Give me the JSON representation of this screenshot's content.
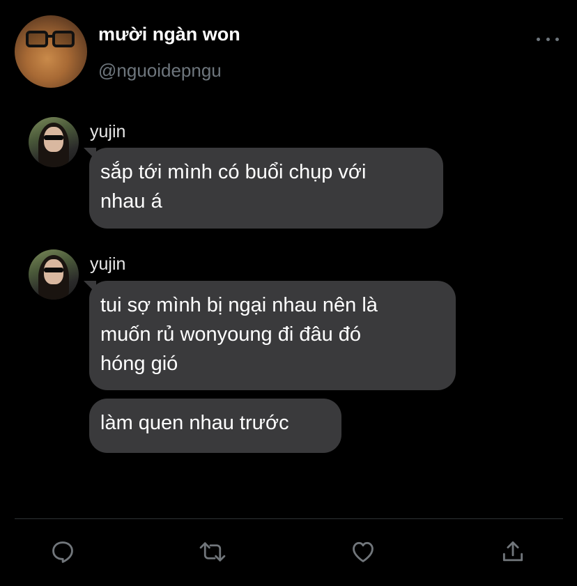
{
  "tweet": {
    "display_name": "mười ngàn won",
    "handle": "@nguoidepngu"
  },
  "messages": [
    {
      "sender": "yujin",
      "bubbles": [
        {
          "lines": [
            "sắp tới mình có buổi chụp với",
            "nhau á"
          ]
        }
      ]
    },
    {
      "sender": "yujin",
      "bubbles": [
        {
          "lines": [
            "tui sợ mình bị ngại nhau nên là",
            "muốn rủ wonyoung đi đâu đó",
            "hóng gió"
          ]
        },
        {
          "lines": [
            "làm quen nhau trước"
          ]
        }
      ]
    }
  ],
  "actions": [
    {
      "icon": "reply-icon"
    },
    {
      "icon": "retweet-icon"
    },
    {
      "icon": "like-icon"
    },
    {
      "icon": "share-icon"
    }
  ],
  "colors": {
    "background": "#000000",
    "bubble": "#3a3a3c",
    "secondary_text": "#6e767d",
    "icon": "#71767b",
    "divider": "#2f3336"
  }
}
